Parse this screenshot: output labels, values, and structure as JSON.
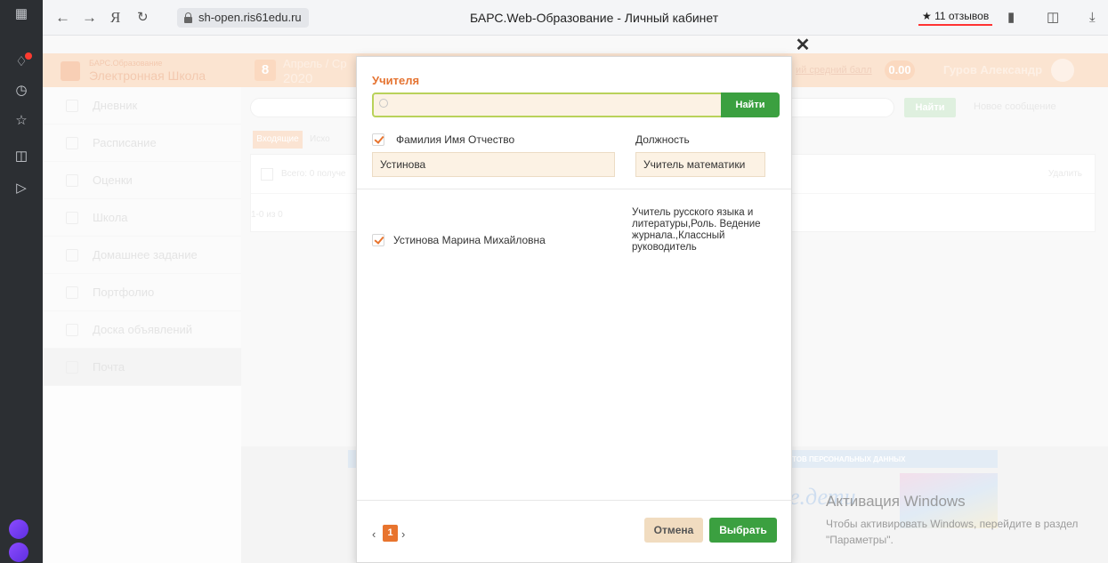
{
  "browser": {
    "url": "sh-open.ris61edu.ru",
    "page_title": "БАРС.Web-Образование - Личный кабинет",
    "reviews": "11 отзывов",
    "notification_badge_color": "#ff3b30"
  },
  "app": {
    "logo_small": "БАРС.Образование",
    "logo_big": "Электронная Школа",
    "date_day": "8",
    "date_text": "Апрель / Ср",
    "date_year": "2020",
    "avg_link": "ий средний балл",
    "avg_value": "0.00",
    "user_name": "Гуров Александр",
    "accent_color": "#e8742e",
    "green_color": "#3ba040",
    "menu": [
      {
        "label": "Дневник",
        "icon": "diary-icon"
      },
      {
        "label": "Расписание",
        "icon": "schedule-icon"
      },
      {
        "label": "Оценки",
        "icon": "grades-icon"
      },
      {
        "label": "Школа",
        "icon": "school-icon"
      },
      {
        "label": "Домашнее задание",
        "icon": "homework-icon"
      },
      {
        "label": "Портфолио",
        "icon": "portfolio-icon"
      },
      {
        "label": "Доска объявлений",
        "icon": "announcements-icon"
      },
      {
        "label": "Почта",
        "icon": "mail-icon"
      }
    ],
    "mail": {
      "find_label": "Найти",
      "new_message": "Новое сообщение",
      "tab_incoming": "Входящие",
      "tab_outgoing": "Исхо",
      "total": "Всего: 0 получе",
      "delete": "Удалить",
      "count": "1-0 из 0"
    },
    "footer_banner": "КТОВ ПЕРСОНАЛЬНЫХ ДАННЫХ",
    "footer_logo": "е.дети"
  },
  "modal": {
    "title": "Учителя",
    "search_placeholder": "",
    "find_label": "Найти",
    "col_fio": "Фамилия Имя Отчество",
    "col_position": "Должность",
    "filter_fio_value": "Устинова",
    "filter_position_value": "Учитель математики",
    "results": [
      {
        "name": "Устинова Марина Михайловна",
        "position": "Учитель русского языка и литературы,Роль. Ведение журнала.,Классный руководитель",
        "checked": true
      }
    ],
    "pagination": {
      "current": "1"
    },
    "cancel_label": "Отмена",
    "select_label": "Выбрать"
  },
  "watermark": {
    "title": "Активация Windows",
    "subtitle": "Чтобы активировать Windows, перейдите в раздел \"Параметры\"."
  }
}
